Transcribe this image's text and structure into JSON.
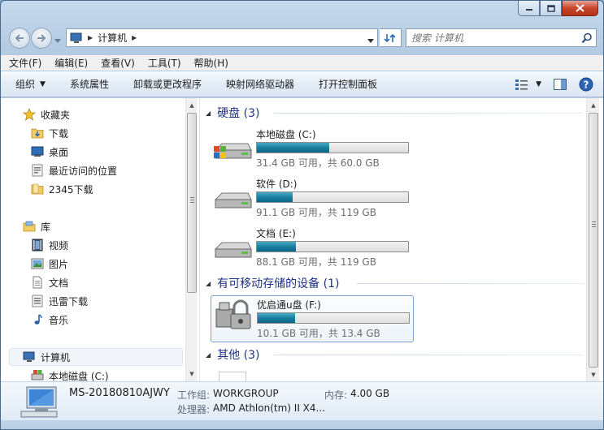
{
  "window": {
    "caption_buttons": [
      "minimize-icon",
      "maximize-icon",
      "close-icon"
    ]
  },
  "address_bar": {
    "crumbs": [
      "计算机"
    ],
    "search_placeholder": "搜索 计算机"
  },
  "menu": [
    "文件(F)",
    "编辑(E)",
    "查看(V)",
    "工具(T)",
    "帮助(H)"
  ],
  "toolbar": {
    "organize": "组织",
    "system_properties": "系统属性",
    "uninstall": "卸载或更改程序",
    "map_drive": "映射网络驱动器",
    "control_panel": "打开控制面板"
  },
  "nav": {
    "favorites": "收藏夹",
    "favorites_items": [
      "下载",
      "桌面",
      "最近访问的位置",
      "2345下载"
    ],
    "libraries": "库",
    "library_items": [
      "视频",
      "图片",
      "文档",
      "迅雷下载",
      "音乐"
    ],
    "computer": "计算机",
    "computer_items": [
      "本地磁盘 (C:)"
    ]
  },
  "groups": {
    "hard_disks": "硬盘 (3)",
    "removable": "有可移动存储的设备 (1)",
    "other": "其他 (3)"
  },
  "drives": [
    {
      "name": "本地磁盘 (C:)",
      "free": "31.4 GB 可用，共 60.0 GB",
      "used_fraction": 0.477
    },
    {
      "name": "软件 (D:)",
      "free": "91.1 GB 可用，共 119 GB",
      "used_fraction": 0.234
    },
    {
      "name": "文档 (E:)",
      "free": "88.1 GB 可用，共 119 GB",
      "used_fraction": 0.26
    }
  ],
  "removable_drives": [
    {
      "name": "优启通u盘 (F:)",
      "free": "10.1 GB 可用，共 13.4 GB",
      "used_fraction": 0.246
    }
  ],
  "details": {
    "computer_name": "MS-20180810AJWY",
    "workgroup_label": "工作组:",
    "workgroup_value": "WORKGROUP",
    "memory_label": "内存:",
    "memory_value": "4.00 GB",
    "cpu_label": "处理器:",
    "cpu_value": "AMD Athlon(tm) II X4..."
  },
  "colors": {
    "group_header": "#1e3287",
    "bar_fill": "#1a7fa0",
    "close_button": "#c8462e"
  }
}
